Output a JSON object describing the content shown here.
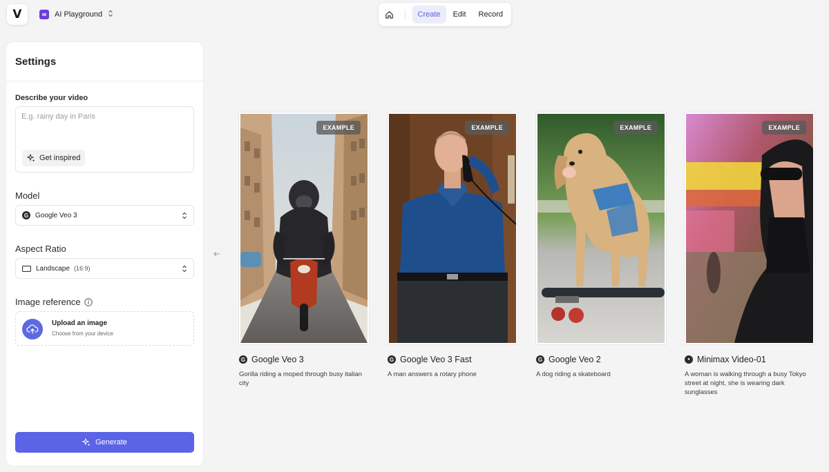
{
  "app": {
    "logo_letter": "V",
    "workspace_name": "AI Playground"
  },
  "topnav": {
    "tabs": [
      {
        "label": "Create",
        "active": true
      },
      {
        "label": "Edit",
        "active": false
      },
      {
        "label": "Record",
        "active": false
      }
    ]
  },
  "settings": {
    "title": "Settings",
    "describe_label": "Describe your video",
    "describe_placeholder": "E.g. rainy day in Paris",
    "describe_value": "",
    "get_inspired_label": "Get inspired",
    "model_label": "Model",
    "model_value": "Google Veo 3",
    "aspect_label": "Aspect Ratio",
    "aspect_value": "Landscape",
    "aspect_ratio": "(16:9)",
    "image_reference_label": "Image reference",
    "upload_title": "Upload an image",
    "upload_subtitle": "Choose from your device",
    "generate_label": "Generate"
  },
  "gallery": {
    "badge_label": "EXAMPLE",
    "examples": [
      {
        "model": "Google Veo 3",
        "description": "Gorilla riding a moped through busy italian city",
        "model_icon": "google-icon"
      },
      {
        "model": "Google Veo 3 Fast",
        "description": "A man answers a rotary phone",
        "model_icon": "google-icon"
      },
      {
        "model": "Google Veo 2",
        "description": "A dog riding a skateboard",
        "model_icon": "google-icon"
      },
      {
        "model": "Minimax Video-01",
        "description": "A woman is walking through a busy Tokyo street at night, she is wearing dark sunglasses",
        "model_icon": "minimax-icon"
      }
    ]
  },
  "colors": {
    "accent": "#5b63e6",
    "active_tab_bg": "#ececfb",
    "workspace_badge": "#6d3fd8"
  }
}
